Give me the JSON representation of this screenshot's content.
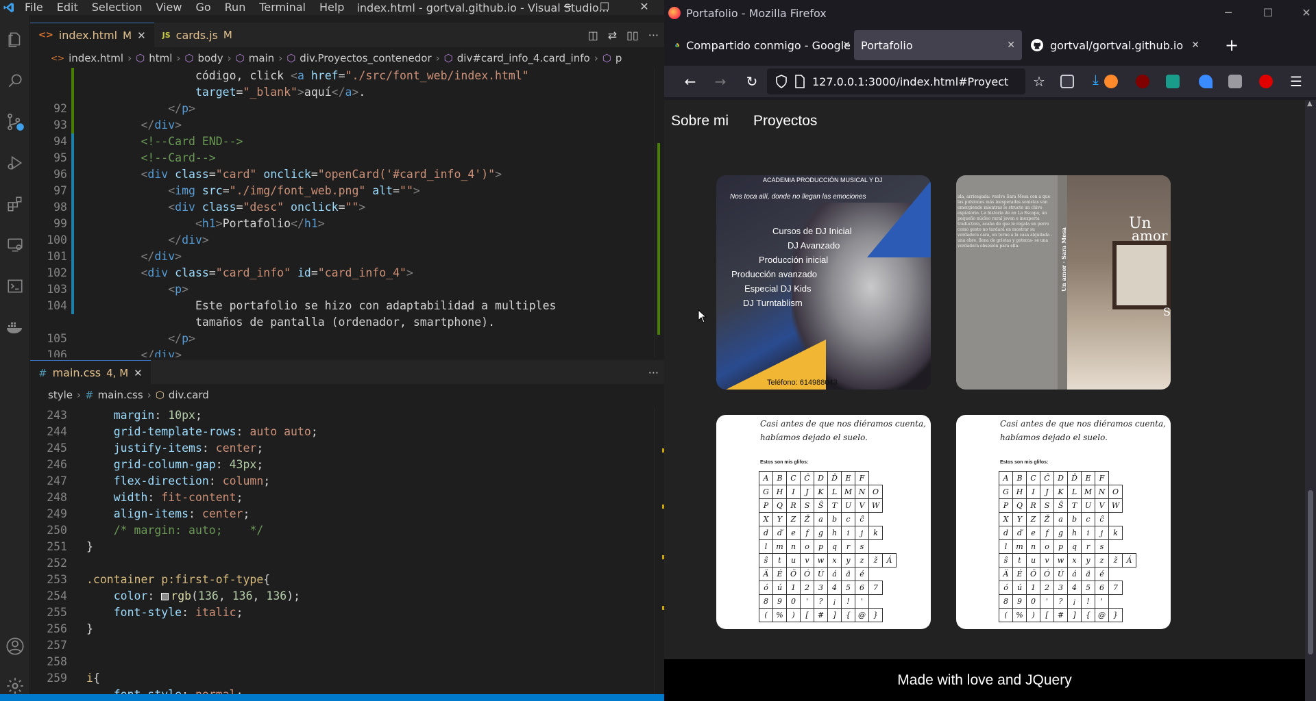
{
  "vscode": {
    "menu": [
      "File",
      "Edit",
      "Selection",
      "View",
      "Go",
      "Run",
      "Terminal",
      "Help"
    ],
    "window_title": "index.html - gortval.github.io - Visual Studio...",
    "tabs": [
      {
        "label": "index.html",
        "status": "M",
        "icon": "<>"
      },
      {
        "label": "cards.js",
        "status": "M",
        "icon": "JS"
      }
    ],
    "breadcrumb": [
      "index.html",
      "html",
      "body",
      "main",
      "div.Proyectos_contenedor",
      "div#card_info_4.card_info",
      "p"
    ],
    "html_lines": [
      {
        "num": "",
        "parts": [
          [
            "t-txt",
            "                código, click "
          ],
          [
            "t-brk",
            "<"
          ],
          [
            "t-tag",
            "a "
          ],
          [
            "t-attr",
            "href"
          ],
          [
            "t-txt",
            "="
          ],
          [
            "t-str",
            "\"./src/font_web/index.html\""
          ]
        ]
      },
      {
        "num": "",
        "parts": [
          [
            "t-attr",
            "                target"
          ],
          [
            "t-txt",
            "="
          ],
          [
            "t-str",
            "\"_blank\""
          ],
          [
            "t-brk",
            ">"
          ],
          [
            "t-txt",
            "aquí"
          ],
          [
            "t-brk",
            "</"
          ],
          [
            "t-tag",
            "a"
          ],
          [
            "t-brk",
            ">"
          ],
          [
            "t-txt",
            "."
          ]
        ]
      },
      {
        "num": "92",
        "parts": [
          [
            "t-brk",
            "            </"
          ],
          [
            "t-tag",
            "p"
          ],
          [
            "t-brk",
            ">"
          ]
        ]
      },
      {
        "num": "93",
        "parts": [
          [
            "t-brk",
            "        </"
          ],
          [
            "t-tag",
            "div"
          ],
          [
            "t-brk",
            ">"
          ]
        ]
      },
      {
        "num": "94",
        "parts": [
          [
            "t-com",
            "        <!--Card END-->"
          ]
        ]
      },
      {
        "num": "95",
        "parts": [
          [
            "t-com",
            "        <!--Card-->"
          ]
        ]
      },
      {
        "num": "96",
        "parts": [
          [
            "t-brk",
            "        <"
          ],
          [
            "t-tag",
            "div "
          ],
          [
            "t-attr",
            "class"
          ],
          [
            "t-txt",
            "="
          ],
          [
            "t-str",
            "\"card\" "
          ],
          [
            "t-attr",
            "onclick"
          ],
          [
            "t-txt",
            "="
          ],
          [
            "t-str",
            "\"openCard('#card_info_4')\""
          ],
          [
            "t-brk",
            ">"
          ]
        ]
      },
      {
        "num": "97",
        "parts": [
          [
            "t-brk",
            "            <"
          ],
          [
            "t-tag",
            "img "
          ],
          [
            "t-attr",
            "src"
          ],
          [
            "t-txt",
            "="
          ],
          [
            "t-str",
            "\"./img/font_web.png\" "
          ],
          [
            "t-attr",
            "alt"
          ],
          [
            "t-txt",
            "="
          ],
          [
            "t-str",
            "\"\""
          ],
          [
            "t-brk",
            ">"
          ]
        ]
      },
      {
        "num": "98",
        "parts": [
          [
            "t-brk",
            "            <"
          ],
          [
            "t-tag",
            "div "
          ],
          [
            "t-attr",
            "class"
          ],
          [
            "t-txt",
            "="
          ],
          [
            "t-str",
            "\"desc\" "
          ],
          [
            "t-attr",
            "onclick"
          ],
          [
            "t-txt",
            "="
          ],
          [
            "t-str",
            "\"\""
          ],
          [
            "t-brk",
            ">"
          ]
        ]
      },
      {
        "num": "99",
        "parts": [
          [
            "t-brk",
            "                <"
          ],
          [
            "t-tag",
            "h1"
          ],
          [
            "t-brk",
            ">"
          ],
          [
            "t-txt",
            "Portafolio"
          ],
          [
            "t-brk",
            "</"
          ],
          [
            "t-tag",
            "h1"
          ],
          [
            "t-brk",
            ">"
          ]
        ]
      },
      {
        "num": "100",
        "parts": [
          [
            "t-brk",
            "            </"
          ],
          [
            "t-tag",
            "div"
          ],
          [
            "t-brk",
            ">"
          ]
        ]
      },
      {
        "num": "101",
        "parts": [
          [
            "t-brk",
            "        </"
          ],
          [
            "t-tag",
            "div"
          ],
          [
            "t-brk",
            ">"
          ]
        ]
      },
      {
        "num": "102",
        "parts": [
          [
            "t-brk",
            "        <"
          ],
          [
            "t-tag",
            "div "
          ],
          [
            "t-attr",
            "class"
          ],
          [
            "t-txt",
            "="
          ],
          [
            "t-str",
            "\"card_info\" "
          ],
          [
            "t-attr",
            "id"
          ],
          [
            "t-txt",
            "="
          ],
          [
            "t-str",
            "\"card_info_4\""
          ],
          [
            "t-brk",
            ">"
          ]
        ]
      },
      {
        "num": "103",
        "parts": [
          [
            "t-brk",
            "            <"
          ],
          [
            "t-tag",
            "p"
          ],
          [
            "t-brk",
            ">"
          ]
        ]
      },
      {
        "num": "104",
        "parts": [
          [
            "t-txt",
            "                Este portafolio se hizo con adaptabilidad a multiples"
          ]
        ]
      },
      {
        "num": "",
        "parts": [
          [
            "t-txt",
            "                tamaños de pantalla (ordenador, smartphone)."
          ]
        ]
      },
      {
        "num": "105",
        "parts": [
          [
            "t-brk",
            "            </"
          ],
          [
            "t-tag",
            "p"
          ],
          [
            "t-brk",
            ">"
          ]
        ]
      },
      {
        "num": "106",
        "parts": [
          [
            "t-brk",
            "        </"
          ],
          [
            "t-tag",
            "div"
          ],
          [
            "t-brk",
            ">"
          ]
        ]
      }
    ],
    "css_tab": {
      "label": "main.css",
      "status": "4, M"
    },
    "css_breadcrumb": [
      "style",
      "main.css",
      "div.card"
    ],
    "css_lines": [
      {
        "num": "243",
        "parts": [
          [
            "t-prop",
            "    margin"
          ],
          [
            "t-txt",
            ": "
          ],
          [
            "t-num",
            "10px"
          ],
          [
            "t-txt",
            ";"
          ]
        ]
      },
      {
        "num": "244",
        "parts": [
          [
            "t-prop",
            "    grid-template-rows"
          ],
          [
            "t-txt",
            ": "
          ],
          [
            "t-val",
            "auto auto"
          ],
          [
            "t-txt",
            ";"
          ]
        ]
      },
      {
        "num": "245",
        "parts": [
          [
            "t-prop",
            "    justify-items"
          ],
          [
            "t-txt",
            ": "
          ],
          [
            "t-val",
            "center"
          ],
          [
            "t-txt",
            ";"
          ]
        ]
      },
      {
        "num": "246",
        "parts": [
          [
            "t-prop",
            "    grid-column-gap"
          ],
          [
            "t-txt",
            ": "
          ],
          [
            "t-num",
            "43px"
          ],
          [
            "t-txt",
            ";"
          ]
        ]
      },
      {
        "num": "247",
        "parts": [
          [
            "t-prop",
            "    flex-direction"
          ],
          [
            "t-txt",
            ": "
          ],
          [
            "t-val",
            "column"
          ],
          [
            "t-txt",
            ";"
          ]
        ]
      },
      {
        "num": "248",
        "parts": [
          [
            "t-prop",
            "    width"
          ],
          [
            "t-txt",
            ": "
          ],
          [
            "t-val",
            "fit-content"
          ],
          [
            "t-txt",
            ";"
          ]
        ]
      },
      {
        "num": "249",
        "parts": [
          [
            "t-prop",
            "    align-items"
          ],
          [
            "t-txt",
            ": "
          ],
          [
            "t-val",
            "center"
          ],
          [
            "t-txt",
            ";"
          ]
        ]
      },
      {
        "num": "250",
        "parts": [
          [
            "t-com",
            "    /* margin: auto;    */"
          ]
        ]
      },
      {
        "num": "251",
        "parts": [
          [
            "t-txt",
            "}"
          ]
        ]
      },
      {
        "num": "252",
        "parts": [
          [
            "t-txt",
            ""
          ]
        ]
      },
      {
        "num": "253",
        "parts": [
          [
            "t-sel",
            ".container p:first-of-type"
          ],
          [
            "t-txt",
            "{"
          ]
        ]
      },
      {
        "num": "254",
        "parts": [
          [
            "t-prop",
            "    color"
          ],
          [
            "t-txt",
            ": "
          ],
          [
            "swatch",
            ""
          ],
          [
            "t-fn",
            "rgb"
          ],
          [
            "t-txt",
            "("
          ],
          [
            "t-num",
            "136"
          ],
          [
            "t-txt",
            ", "
          ],
          [
            "t-num",
            "136"
          ],
          [
            "t-txt",
            ", "
          ],
          [
            "t-num",
            "136"
          ],
          [
            "t-txt",
            ");"
          ]
        ]
      },
      {
        "num": "255",
        "parts": [
          [
            "t-prop",
            "    font-style"
          ],
          [
            "t-txt",
            ": "
          ],
          [
            "t-val",
            "italic"
          ],
          [
            "t-txt",
            ";"
          ]
        ]
      },
      {
        "num": "256",
        "parts": [
          [
            "t-txt",
            "}"
          ]
        ]
      },
      {
        "num": "257",
        "parts": [
          [
            "t-txt",
            ""
          ]
        ]
      },
      {
        "num": "258",
        "parts": [
          [
            "t-txt",
            ""
          ]
        ]
      },
      {
        "num": "259",
        "parts": [
          [
            "t-sel",
            "i"
          ],
          [
            "t-txt",
            "{"
          ]
        ]
      },
      {
        "num": "",
        "parts": [
          [
            "t-prop",
            "    font-style"
          ],
          [
            "t-txt",
            ": "
          ],
          [
            "t-val",
            "normal"
          ],
          [
            "t-txt",
            ";"
          ]
        ]
      }
    ]
  },
  "firefox": {
    "window_title": "Portafolio - Mozilla Firefox",
    "tabs": [
      {
        "label": "Compartido conmigo - Google",
        "icon": "google-drive-icon"
      },
      {
        "label": "Portafolio",
        "icon": ""
      },
      {
        "label": "gortval/gortval.github.io",
        "icon": "github-icon"
      }
    ],
    "url": "127.0.0.1:3000/index.html#Proyect",
    "page": {
      "nav": [
        "Sobre mi",
        "Proyectos"
      ],
      "footer": "Made with love and JQuery",
      "card_dj": {
        "header": "ACADEMIA PRODUCCIÓN MUSICAL Y DJ",
        "tagline": "Nos toca allí, donde no llegan las emociones",
        "courses": [
          "Cursos de DJ Inicial",
          "DJ Avanzado",
          "Producción inicial",
          "Producción avanzado",
          "Especial DJ Kids",
          "DJ Turntablism"
        ],
        "phone": "Teléfono: 614988043"
      },
      "card_book": {
        "title_line1": "Un",
        "title_line2": "amor",
        "spine": "Un amor · Sara Mesa",
        "corner": "Sa",
        "blurb": "ida, arriesgada: vuelve Sara Mesa con a que las pulsiones más inesperadas sonistas van emergiendo mientras le structe un chivo expiatorio. La historia de en La Escapa, un pequeño núcleo rural joven e inexperta traductora, acaba de que le regala un perro como gesto no tardará en mostrar su verdadera cara, en torno a la casa alquilada -una obre, llena de grietas y goteras- se una verdadera obsesión para ella."
      },
      "card_font": {
        "line1": "Casi antes de que nos diéramos cuenta,",
        "line2": "habíamos dejado el suelo.",
        "label": "Estos son mis glifos:",
        "glyphs": [
          [
            "A",
            "B",
            "C",
            "Ĉ",
            "D",
            "Ď",
            "E",
            "F"
          ],
          [
            "G",
            "H",
            "I",
            "J",
            "K",
            "L",
            "M",
            "N",
            "O"
          ],
          [
            "P",
            "Q",
            "R",
            "S",
            "Ŝ",
            "T",
            "U",
            "V",
            "W"
          ],
          [
            "X",
            "Y",
            "Z",
            "Ž",
            "a",
            "b",
            "c",
            "ĉ"
          ],
          [
            "d",
            "ď",
            "e",
            "f",
            "g",
            "h",
            "i",
            "j",
            "k"
          ],
          [
            "l",
            "m",
            "n",
            "o",
            "p",
            "q",
            "r",
            "s"
          ],
          [
            "ŝ",
            "t",
            "u",
            "v",
            "w",
            "x",
            "y",
            "z",
            "ž",
            "Á"
          ],
          [
            "Ä",
            "É",
            "Ö",
            "Ó",
            "Ú",
            "á",
            "ä",
            "é"
          ],
          [
            "ó",
            "ú",
            "1",
            "2",
            "3",
            "4",
            "5",
            "6",
            "7"
          ],
          [
            "8",
            "9",
            "0",
            "'",
            "?",
            "¡",
            "!",
            "'"
          ],
          [
            "(",
            "%",
            ")",
            "[",
            "#",
            "]",
            "{",
            "@",
            "}"
          ]
        ]
      }
    }
  },
  "colors": {
    "vscode_bg": "#1e1e1e",
    "vscode_accent": "#007acc",
    "firefox_bg": "#1c1b22",
    "page_bg": "#222222"
  }
}
